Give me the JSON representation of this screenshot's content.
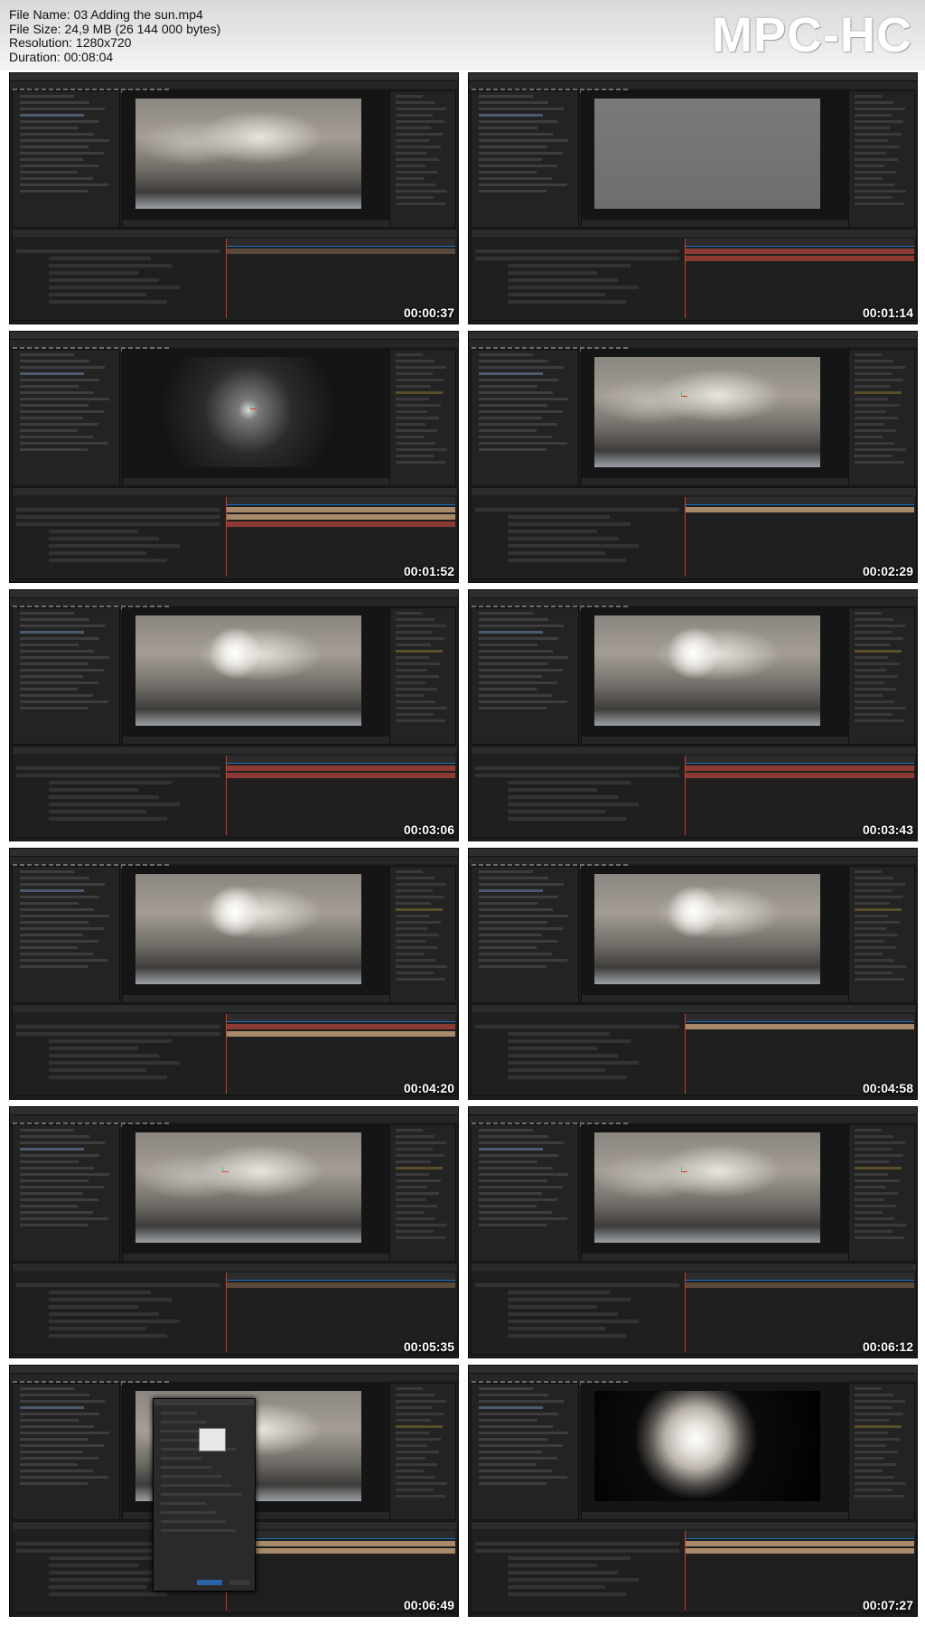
{
  "info": {
    "file_name": "File Name: 03 Adding the sun.mp4",
    "file_size": "File Size: 24,9 MB (26 144 000 bytes)",
    "resolution": "Resolution: 1280x720",
    "duration": "Duration: 00:08:04"
  },
  "logo": "MPC-HC",
  "thumbnails": [
    {
      "timestamp": "00:00:37",
      "scene": "sky",
      "bars": [
        "dark"
      ]
    },
    {
      "timestamp": "00:01:14",
      "scene": "sky-gray",
      "bars": [
        "red",
        "red"
      ]
    },
    {
      "timestamp": "00:01:52",
      "scene": "sky-dark",
      "bars": [
        "tan",
        "tan",
        "red"
      ]
    },
    {
      "timestamp": "00:02:29",
      "scene": "sky",
      "bars": [
        "tan"
      ]
    },
    {
      "timestamp": "00:03:06",
      "scene": "sky-sunlit",
      "bars": [
        "red",
        "red"
      ]
    },
    {
      "timestamp": "00:03:43",
      "scene": "sky-sunlit",
      "bars": [
        "red",
        "red"
      ]
    },
    {
      "timestamp": "00:04:20",
      "scene": "sky-sunlit",
      "bars": [
        "red",
        "tan"
      ]
    },
    {
      "timestamp": "00:04:58",
      "scene": "sky-sunlit",
      "bars": [
        "tan"
      ]
    },
    {
      "timestamp": "00:05:35",
      "scene": "sky",
      "bars": [
        "dark"
      ]
    },
    {
      "timestamp": "00:06:12",
      "scene": "sky",
      "bars": [
        "dark"
      ]
    },
    {
      "timestamp": "00:06:49",
      "scene": "sky",
      "bars": [
        "tan",
        "tan"
      ]
    },
    {
      "timestamp": "00:07:27",
      "scene": "sky-orb",
      "bars": [
        "tan",
        "tan"
      ]
    }
  ]
}
